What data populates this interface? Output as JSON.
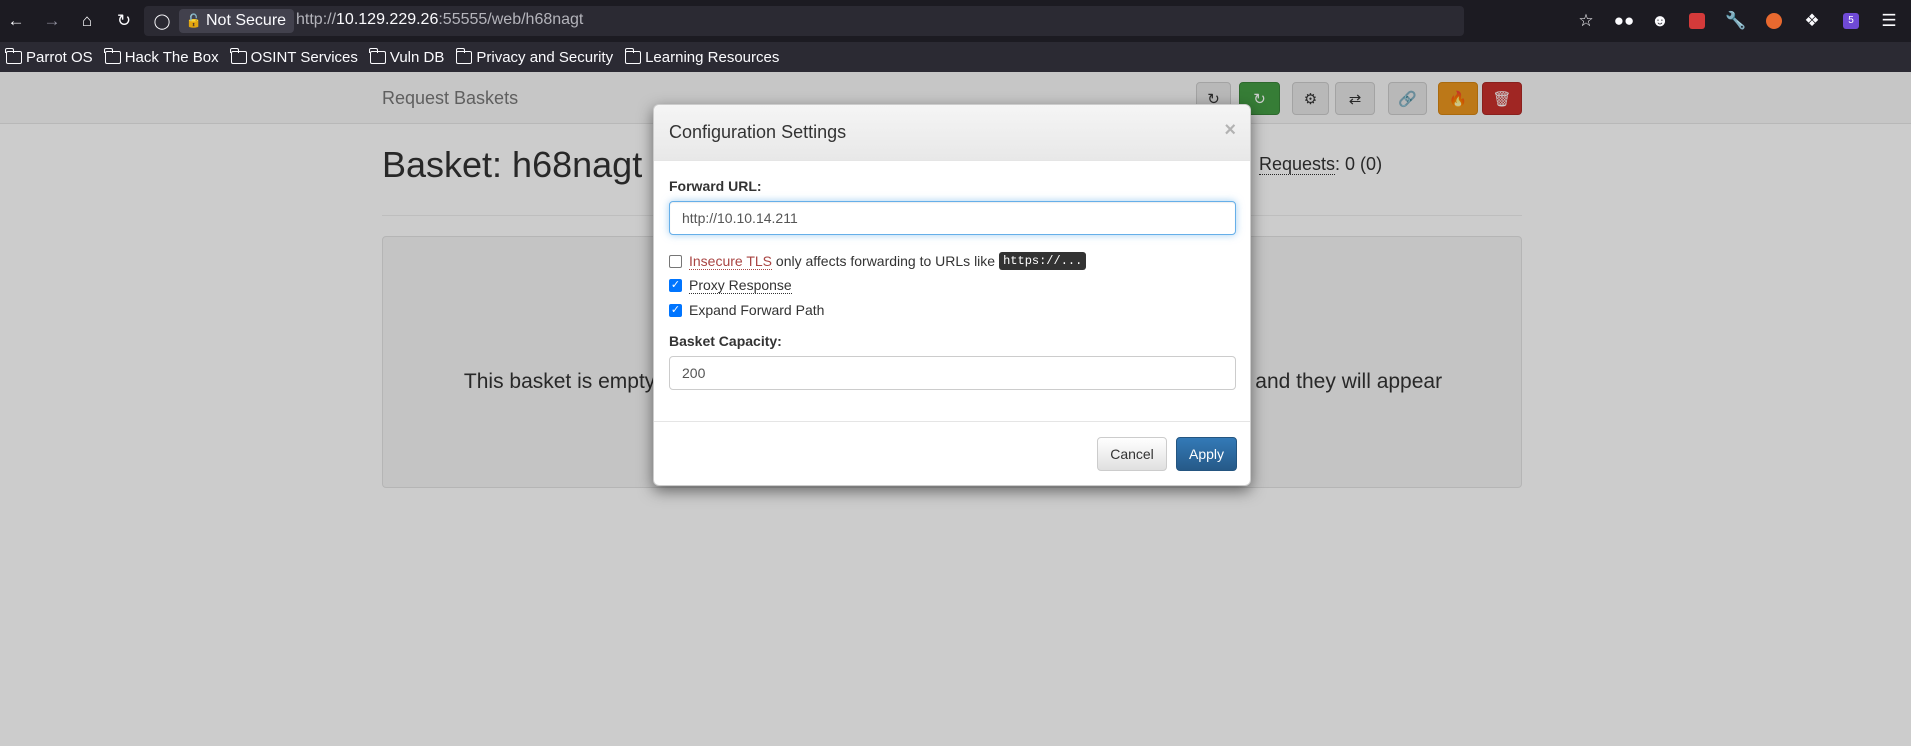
{
  "browser": {
    "security_label": "Not Secure",
    "url_prefix": "http://",
    "url_host": "10.129.229.26",
    "url_rest": ":55555/web/h68nagt",
    "extension_badge": "5",
    "bookmarks": [
      "Parrot OS",
      "Hack The Box",
      "OSINT Services",
      "Vuln DB",
      "Privacy and Security",
      "Learning Resources"
    ]
  },
  "app": {
    "brand": "Request Baskets",
    "basket_title": "Basket: h68nagt",
    "requests_label": "Requests",
    "requests_value": ": 0 (0)",
    "empty_left": "This basket is empty",
    "empty_right": "and they will appear"
  },
  "modal": {
    "title": "Configuration Settings",
    "close": "×",
    "forward_url_label": "Forward URL:",
    "forward_url_value": "http://10.10.14.211",
    "insecure_tls_label": "Insecure TLS",
    "insecure_tls_hint": " only affects forwarding to URLs like",
    "insecure_tls_code": "https://...",
    "proxy_response_label": "Proxy Response",
    "expand_path_label": "Expand Forward Path",
    "capacity_label": "Basket Capacity:",
    "capacity_value": "200",
    "cancel_label": "Cancel",
    "apply_label": "Apply"
  }
}
